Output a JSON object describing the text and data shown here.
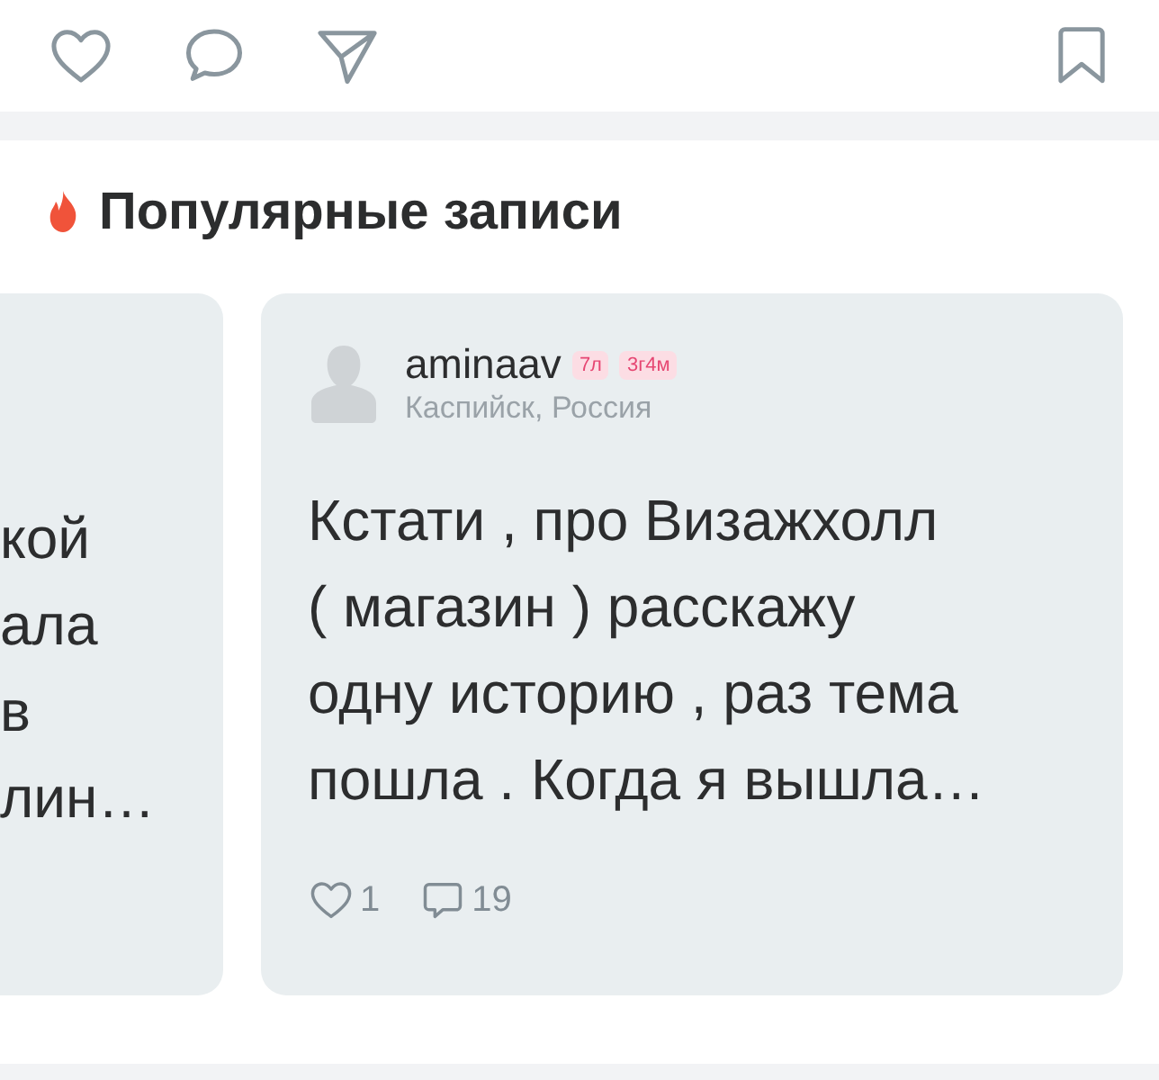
{
  "actions": {
    "liked": false,
    "bookmarked": false
  },
  "section": {
    "title": "Популярные записи"
  },
  "cards": [
    {
      "kind": "partial",
      "lines": [
        "кой",
        "ала",
        "в",
        "лин…"
      ]
    },
    {
      "kind": "post",
      "author": "aminaav",
      "badges": [
        "7л",
        "3г4м"
      ],
      "location": "Каспийск, Россия",
      "lines": [
        "Кстати , про Визажхолл",
        "( магазин ) расскажу",
        "одну историю , раз тема",
        "пошла .  Когда я вышла…"
      ],
      "likes": "1",
      "comments": "19"
    }
  ]
}
